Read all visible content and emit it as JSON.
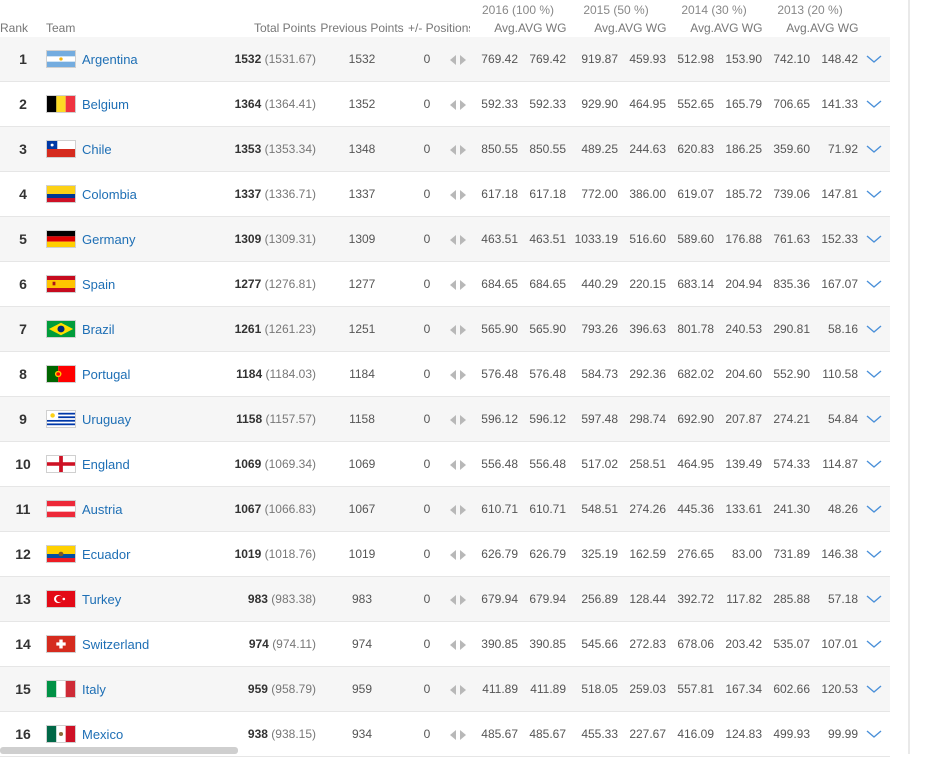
{
  "headers": {
    "rank": "Rank",
    "team": "Team",
    "total": "Total Points",
    "prev": "Previous Points",
    "pos": "+/- Positions",
    "years": [
      {
        "label": "2016 (100 %)",
        "avg": "Avg.",
        "wgt": "AVG WGT"
      },
      {
        "label": "2015 (50 %)",
        "avg": "Avg.",
        "wgt": "AVG WGT"
      },
      {
        "label": "2014 (30 %)",
        "avg": "Avg.",
        "wgt": "AVG WGT"
      },
      {
        "label": "2013 (20 %)",
        "avg": "Avg.",
        "wgt": "AVG WGT"
      }
    ]
  },
  "icons": {
    "move": "left-right-arrows-icon",
    "expand": "chevron-down-icon"
  },
  "colors": {
    "link": "#1e6fb5",
    "stripe": "#f6f6f6",
    "chevron": "#4a90d9"
  },
  "rows": [
    {
      "rank": "1",
      "team": "Argentina",
      "flag": "argentina",
      "total": "1532",
      "exact": "(1531.67)",
      "prev": "1532",
      "pos": "0",
      "v": [
        "769.42",
        "769.42",
        "919.87",
        "459.93",
        "512.98",
        "153.90",
        "742.10",
        "148.42"
      ]
    },
    {
      "rank": "2",
      "team": "Belgium",
      "flag": "belgium",
      "total": "1364",
      "exact": "(1364.41)",
      "prev": "1352",
      "pos": "0",
      "v": [
        "592.33",
        "592.33",
        "929.90",
        "464.95",
        "552.65",
        "165.79",
        "706.65",
        "141.33"
      ]
    },
    {
      "rank": "3",
      "team": "Chile",
      "flag": "chile",
      "total": "1353",
      "exact": "(1353.34)",
      "prev": "1348",
      "pos": "0",
      "v": [
        "850.55",
        "850.55",
        "489.25",
        "244.63",
        "620.83",
        "186.25",
        "359.60",
        "71.92"
      ]
    },
    {
      "rank": "4",
      "team": "Colombia",
      "flag": "colombia",
      "total": "1337",
      "exact": "(1336.71)",
      "prev": "1337",
      "pos": "0",
      "v": [
        "617.18",
        "617.18",
        "772.00",
        "386.00",
        "619.07",
        "185.72",
        "739.06",
        "147.81"
      ]
    },
    {
      "rank": "5",
      "team": "Germany",
      "flag": "germany",
      "total": "1309",
      "exact": "(1309.31)",
      "prev": "1309",
      "pos": "0",
      "v": [
        "463.51",
        "463.51",
        "1033.19",
        "516.60",
        "589.60",
        "176.88",
        "761.63",
        "152.33"
      ]
    },
    {
      "rank": "6",
      "team": "Spain",
      "flag": "spain",
      "total": "1277",
      "exact": "(1276.81)",
      "prev": "1277",
      "pos": "0",
      "v": [
        "684.65",
        "684.65",
        "440.29",
        "220.15",
        "683.14",
        "204.94",
        "835.36",
        "167.07"
      ]
    },
    {
      "rank": "7",
      "team": "Brazil",
      "flag": "brazil",
      "total": "1261",
      "exact": "(1261.23)",
      "prev": "1251",
      "pos": "0",
      "v": [
        "565.90",
        "565.90",
        "793.26",
        "396.63",
        "801.78",
        "240.53",
        "290.81",
        "58.16"
      ]
    },
    {
      "rank": "8",
      "team": "Portugal",
      "flag": "portugal",
      "total": "1184",
      "exact": "(1184.03)",
      "prev": "1184",
      "pos": "0",
      "v": [
        "576.48",
        "576.48",
        "584.73",
        "292.36",
        "682.02",
        "204.60",
        "552.90",
        "110.58"
      ]
    },
    {
      "rank": "9",
      "team": "Uruguay",
      "flag": "uruguay",
      "total": "1158",
      "exact": "(1157.57)",
      "prev": "1158",
      "pos": "0",
      "v": [
        "596.12",
        "596.12",
        "597.48",
        "298.74",
        "692.90",
        "207.87",
        "274.21",
        "54.84"
      ]
    },
    {
      "rank": "10",
      "team": "England",
      "flag": "england",
      "total": "1069",
      "exact": "(1069.34)",
      "prev": "1069",
      "pos": "0",
      "v": [
        "556.48",
        "556.48",
        "517.02",
        "258.51",
        "464.95",
        "139.49",
        "574.33",
        "114.87"
      ]
    },
    {
      "rank": "11",
      "team": "Austria",
      "flag": "austria",
      "total": "1067",
      "exact": "(1066.83)",
      "prev": "1067",
      "pos": "0",
      "v": [
        "610.71",
        "610.71",
        "548.51",
        "274.26",
        "445.36",
        "133.61",
        "241.30",
        "48.26"
      ]
    },
    {
      "rank": "12",
      "team": "Ecuador",
      "flag": "ecuador",
      "total": "1019",
      "exact": "(1018.76)",
      "prev": "1019",
      "pos": "0",
      "v": [
        "626.79",
        "626.79",
        "325.19",
        "162.59",
        "276.65",
        "83.00",
        "731.89",
        "146.38"
      ]
    },
    {
      "rank": "13",
      "team": "Turkey",
      "flag": "turkey",
      "total": "983",
      "exact": "(983.38)",
      "prev": "983",
      "pos": "0",
      "v": [
        "679.94",
        "679.94",
        "256.89",
        "128.44",
        "392.72",
        "117.82",
        "285.88",
        "57.18"
      ]
    },
    {
      "rank": "14",
      "team": "Switzerland",
      "flag": "switzerland",
      "total": "974",
      "exact": "(974.11)",
      "prev": "974",
      "pos": "0",
      "v": [
        "390.85",
        "390.85",
        "545.66",
        "272.83",
        "678.06",
        "203.42",
        "535.07",
        "107.01"
      ]
    },
    {
      "rank": "15",
      "team": "Italy",
      "flag": "italy",
      "total": "959",
      "exact": "(958.79)",
      "prev": "959",
      "pos": "0",
      "v": [
        "411.89",
        "411.89",
        "518.05",
        "259.03",
        "557.81",
        "167.34",
        "602.66",
        "120.53"
      ]
    },
    {
      "rank": "16",
      "team": "Mexico",
      "flag": "mexico",
      "total": "938",
      "exact": "(938.15)",
      "prev": "934",
      "pos": "0",
      "v": [
        "485.67",
        "485.67",
        "455.33",
        "227.67",
        "416.09",
        "124.83",
        "499.93",
        "99.99"
      ]
    }
  ]
}
